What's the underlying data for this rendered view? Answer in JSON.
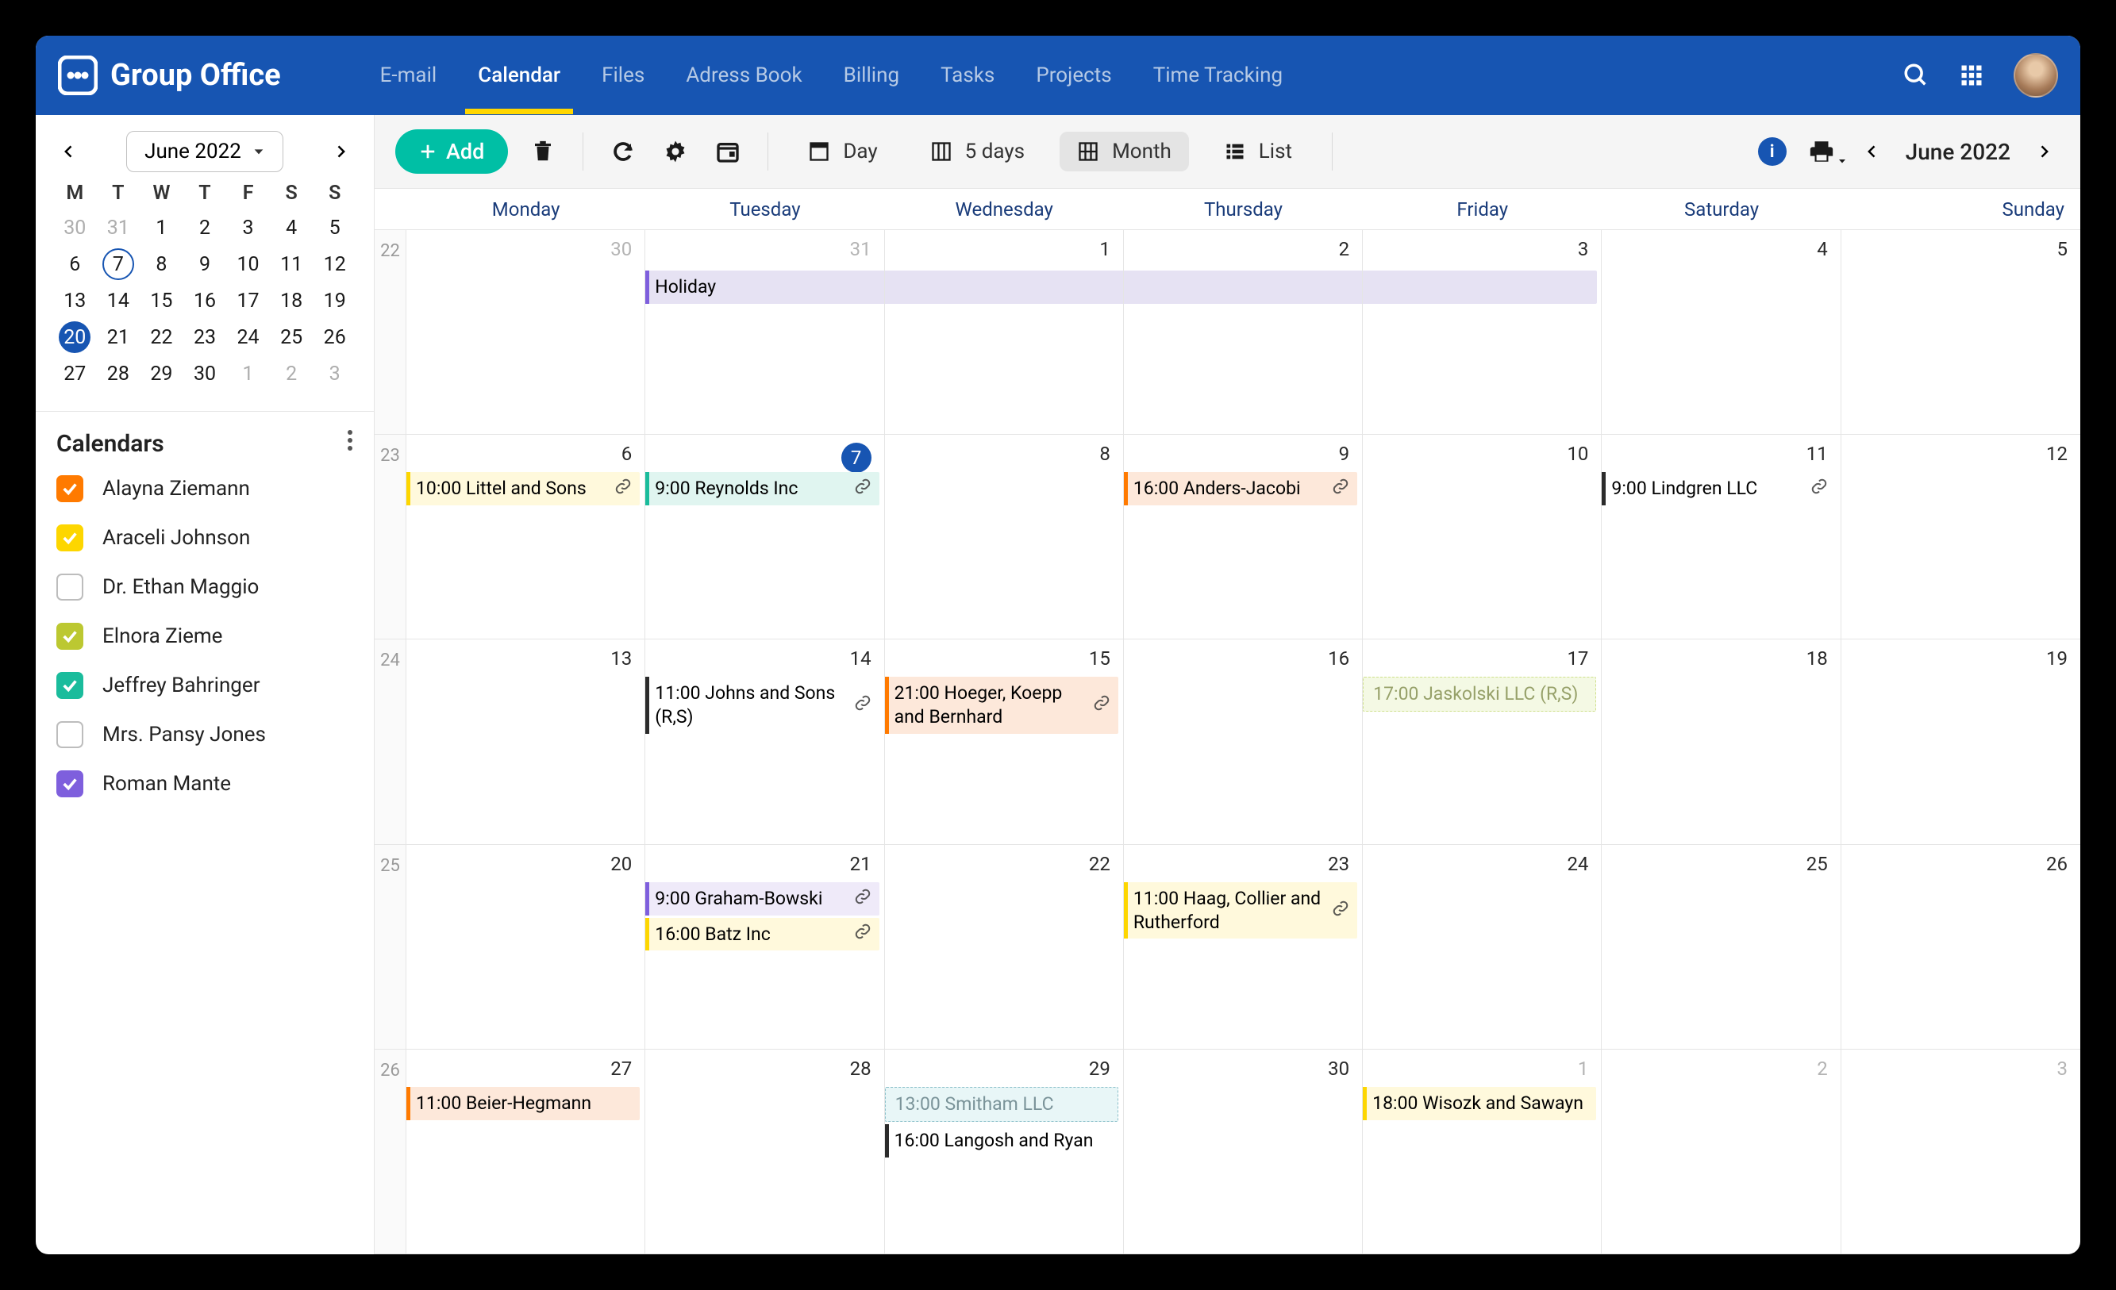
{
  "app": {
    "name": "Group Office"
  },
  "nav": {
    "email": "E-mail",
    "calendar": "Calendar",
    "files": "Files",
    "address_book": "Adress Book",
    "billing": "Billing",
    "tasks": "Tasks",
    "projects": "Projects",
    "time_tracking": "Time Tracking"
  },
  "mini_cal": {
    "month_label": "June 2022",
    "dow": [
      "M",
      "T",
      "W",
      "T",
      "F",
      "S",
      "S"
    ],
    "weeks": [
      [
        {
          "n": "30",
          "m": true
        },
        {
          "n": "31",
          "m": true
        },
        {
          "n": "1"
        },
        {
          "n": "2"
        },
        {
          "n": "3"
        },
        {
          "n": "4"
        },
        {
          "n": "5"
        }
      ],
      [
        {
          "n": "6"
        },
        {
          "n": "7",
          "sel": true
        },
        {
          "n": "8"
        },
        {
          "n": "9"
        },
        {
          "n": "10"
        },
        {
          "n": "11"
        },
        {
          "n": "12"
        }
      ],
      [
        {
          "n": "13"
        },
        {
          "n": "14"
        },
        {
          "n": "15"
        },
        {
          "n": "16"
        },
        {
          "n": "17"
        },
        {
          "n": "18"
        },
        {
          "n": "19"
        }
      ],
      [
        {
          "n": "20",
          "today": true
        },
        {
          "n": "21"
        },
        {
          "n": "22"
        },
        {
          "n": "23"
        },
        {
          "n": "24"
        },
        {
          "n": "25"
        },
        {
          "n": "26"
        }
      ],
      [
        {
          "n": "27"
        },
        {
          "n": "28"
        },
        {
          "n": "29"
        },
        {
          "n": "30"
        },
        {
          "n": "1",
          "m": true
        },
        {
          "n": "2",
          "m": true
        },
        {
          "n": "3",
          "m": true
        }
      ]
    ]
  },
  "calendars": {
    "heading": "Calendars",
    "items": [
      {
        "color": "#ff7a00",
        "checked": true,
        "label": "Alayna Ziemann"
      },
      {
        "color": "#fdd600",
        "checked": true,
        "label": "Araceli Johnson"
      },
      {
        "color": "",
        "checked": false,
        "label": "Dr. Ethan Maggio"
      },
      {
        "color": "#bcc831",
        "checked": true,
        "label": "Elnora Zieme"
      },
      {
        "color": "#1abc9c",
        "checked": true,
        "label": "Jeffrey Bahringer"
      },
      {
        "color": "",
        "checked": false,
        "label": "Mrs. Pansy Jones"
      },
      {
        "color": "#7e5fdd",
        "checked": true,
        "label": "Roman Mante"
      }
    ]
  },
  "toolbar": {
    "add": "Add",
    "views": {
      "day": "Day",
      "fivedays": "5 days",
      "month": "Month",
      "list": "List"
    },
    "current": "June 2022"
  },
  "grid": {
    "day_headers": [
      "Monday",
      "Tuesday",
      "Wednesday",
      "Thursday",
      "Friday",
      "Saturday",
      "Sunday"
    ],
    "weeks": [
      {
        "num": "22",
        "days": [
          {
            "n": "30",
            "m": true,
            "events": []
          },
          {
            "n": "31",
            "m": true,
            "events": [
              {
                "text": "Holiday",
                "bar": "#7e5fdd",
                "bg": "#e6e2f3",
                "span": 4,
                "start_here": true
              }
            ]
          },
          {
            "n": "1",
            "events": []
          },
          {
            "n": "2",
            "events": []
          },
          {
            "n": "3",
            "events": []
          },
          {
            "n": "4",
            "events": []
          },
          {
            "n": "5",
            "events": []
          }
        ]
      },
      {
        "num": "23",
        "days": [
          {
            "n": "6",
            "events": [
              {
                "text": "10:00 Littel and Sons",
                "bar": "#fdd600",
                "bg": "#fff9dc",
                "link": true
              }
            ]
          },
          {
            "n": "7",
            "today": true,
            "events": [
              {
                "text": "9:00 Reynolds Inc",
                "bar": "#1abc9c",
                "bg": "#e0f5f0",
                "link": true
              }
            ]
          },
          {
            "n": "8",
            "events": []
          },
          {
            "n": "9",
            "events": [
              {
                "text": "16:00 Anders-Jacobi",
                "bar": "#ff7a00",
                "bg": "#fde8da",
                "link": true
              }
            ]
          },
          {
            "n": "10",
            "events": []
          },
          {
            "n": "11",
            "events": [
              {
                "text": "9:00 Lindgren LLC",
                "bar": "#2b2b2b",
                "bg": "#fff",
                "link": true
              }
            ]
          },
          {
            "n": "12",
            "events": []
          }
        ]
      },
      {
        "num": "24",
        "days": [
          {
            "n": "13",
            "events": []
          },
          {
            "n": "14",
            "events": [
              {
                "text": "11:00 Johns and Sons (R,S)",
                "bar": "#2b2b2b",
                "bg": "#fff",
                "link": true
              }
            ]
          },
          {
            "n": "15",
            "events": [
              {
                "text": "21:00 Hoeger, Koepp and Bernhard",
                "bar": "#ff7a00",
                "bg": "#fde8da",
                "link": true
              }
            ]
          },
          {
            "n": "16",
            "events": []
          },
          {
            "n": "17",
            "events": [
              {
                "text": "17:00 Jaskolski LLC (R,S)",
                "dashed": "y"
              }
            ]
          },
          {
            "n": "18",
            "events": []
          },
          {
            "n": "19",
            "events": []
          }
        ]
      },
      {
        "num": "25",
        "days": [
          {
            "n": "20",
            "events": []
          },
          {
            "n": "21",
            "events": [
              {
                "text": "9:00 Graham-Bowski",
                "bar": "#7e5fdd",
                "bg": "#efeaf9",
                "link": true
              },
              {
                "text": "16:00 Batz Inc",
                "bar": "#fdd600",
                "bg": "#fff9dc",
                "link": true
              }
            ]
          },
          {
            "n": "22",
            "events": []
          },
          {
            "n": "23",
            "events": [
              {
                "text": "11:00 Haag, Collier and Rutherford",
                "bar": "#fdd600",
                "bg": "#fff9dc",
                "link": true
              }
            ]
          },
          {
            "n": "24",
            "events": []
          },
          {
            "n": "25",
            "events": []
          },
          {
            "n": "26",
            "events": []
          }
        ]
      },
      {
        "num": "26",
        "days": [
          {
            "n": "27",
            "events": [
              {
                "text": "11:00 Beier-Hegmann",
                "bar": "#ff7a00",
                "bg": "#fde8da"
              }
            ]
          },
          {
            "n": "28",
            "events": []
          },
          {
            "n": "29",
            "events": [
              {
                "text": "13:00 Smitham LLC",
                "dashed": "b"
              },
              {
                "text": "16:00 Langosh and Ryan",
                "bar": "#2b2b2b",
                "bg": "#fff"
              }
            ]
          },
          {
            "n": "30",
            "events": []
          },
          {
            "n": "1",
            "m": true,
            "events": [
              {
                "text": "18:00 Wisozk and Sawayn",
                "bar": "#fdd600",
                "bg": "#fff9dc"
              }
            ]
          },
          {
            "n": "2",
            "m": true,
            "events": []
          },
          {
            "n": "3",
            "m": true,
            "events": []
          }
        ]
      }
    ]
  }
}
